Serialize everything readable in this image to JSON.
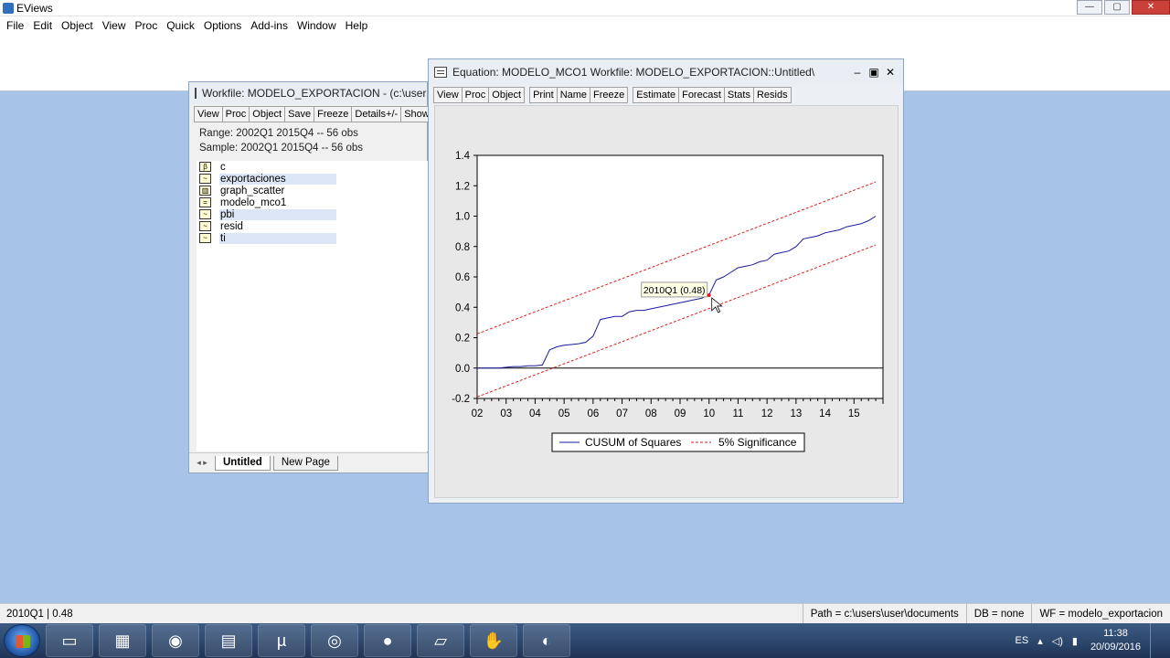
{
  "app": {
    "title": "EViews",
    "win_min": "—",
    "win_max": "▢",
    "win_close": "✕"
  },
  "menu": [
    "File",
    "Edit",
    "Object",
    "View",
    "Proc",
    "Quick",
    "Options",
    "Add-ins",
    "Window",
    "Help"
  ],
  "workfile_window": {
    "title": "Workfile: MODELO_EXPORTACION - (c:\\users\\",
    "toolbar": [
      "View",
      "Proc",
      "Object",
      "Save",
      "Freeze",
      "Details+/-",
      "Show"
    ],
    "range": "Range:  2002Q1 2015Q4  --  56 obs",
    "sample": "Sample: 2002Q1 2015Q4  --  56 obs",
    "objects": [
      {
        "icon": "β",
        "name": "c"
      },
      {
        "icon": "~",
        "name": "exportaciones"
      },
      {
        "icon": "▥",
        "name": "graph_scatter"
      },
      {
        "icon": "=",
        "name": "modelo_mco1"
      },
      {
        "icon": "~",
        "name": "pbi"
      },
      {
        "icon": "~",
        "name": "resid"
      },
      {
        "icon": "~",
        "name": "ti"
      }
    ],
    "tabs": [
      "Untitled",
      "New Page"
    ]
  },
  "equation_window": {
    "title": "Equation: MODELO_MCO1   Workfile: MODELO_EXPORTACION::Untitled\\",
    "ctrl_min": "–",
    "ctrl_max": "▣",
    "ctrl_close": "✕",
    "toolbar_group1": [
      "View",
      "Proc",
      "Object"
    ],
    "toolbar_group2": [
      "Print",
      "Name",
      "Freeze"
    ],
    "toolbar_group3": [
      "Estimate",
      "Forecast",
      "Stats",
      "Resids"
    ]
  },
  "chart_data": {
    "type": "line",
    "title": "",
    "xlabel": "",
    "ylabel": "",
    "ylim": [
      -0.2,
      1.4
    ],
    "yticks": [
      "1.4",
      "1.2",
      "1.0",
      "0.8",
      "0.6",
      "0.4",
      "0.2",
      "0.0",
      "-0.2"
    ],
    "xticks": [
      "02",
      "03",
      "04",
      "05",
      "06",
      "07",
      "08",
      "09",
      "10",
      "11",
      "12",
      "13",
      "14",
      "15"
    ],
    "x_range": [
      2002.0,
      2016.0
    ],
    "series": [
      {
        "name": "CUSUM of Squares",
        "color": "#1a1aa0",
        "style": "solid",
        "values": [
          0.0,
          0.0,
          0.0,
          0.0,
          0.005,
          0.01,
          0.01,
          0.015,
          0.015,
          0.02,
          0.12,
          0.14,
          0.15,
          0.155,
          0.16,
          0.17,
          0.21,
          0.32,
          0.33,
          0.34,
          0.34,
          0.37,
          0.38,
          0.38,
          0.39,
          0.4,
          0.41,
          0.42,
          0.43,
          0.44,
          0.45,
          0.46,
          0.48,
          0.58,
          0.6,
          0.63,
          0.66,
          0.67,
          0.68,
          0.7,
          0.71,
          0.75,
          0.76,
          0.77,
          0.8,
          0.85,
          0.86,
          0.87,
          0.89,
          0.9,
          0.91,
          0.93,
          0.94,
          0.95,
          0.97,
          1.0
        ]
      },
      {
        "name": "5% Significance",
        "color": "#d62020",
        "style": "dashed",
        "upper": [
          0.225,
          1.225
        ],
        "lower": [
          -0.19,
          0.81
        ]
      }
    ],
    "zero_line": true,
    "legend_position": "bottom-center",
    "tooltip": {
      "label": "2010Q1  (0.48)",
      "x_index": 32
    }
  },
  "statusbar": {
    "left": "2010Q1  |  0.48",
    "path": "Path = c:\\users\\user\\documents",
    "db": "DB = none",
    "wf": "WF = modelo_exportacion"
  },
  "taskbar": {
    "apps": [
      "explorer-icon",
      "excel-icon",
      "chrome-icon",
      "word-icon",
      "utorrent-icon",
      "media-icon",
      "skype-icon",
      "notes-icon",
      "eviews-icon",
      "app-icon"
    ],
    "lang": "ES",
    "time": "11:38",
    "date": "20/09/2016"
  }
}
